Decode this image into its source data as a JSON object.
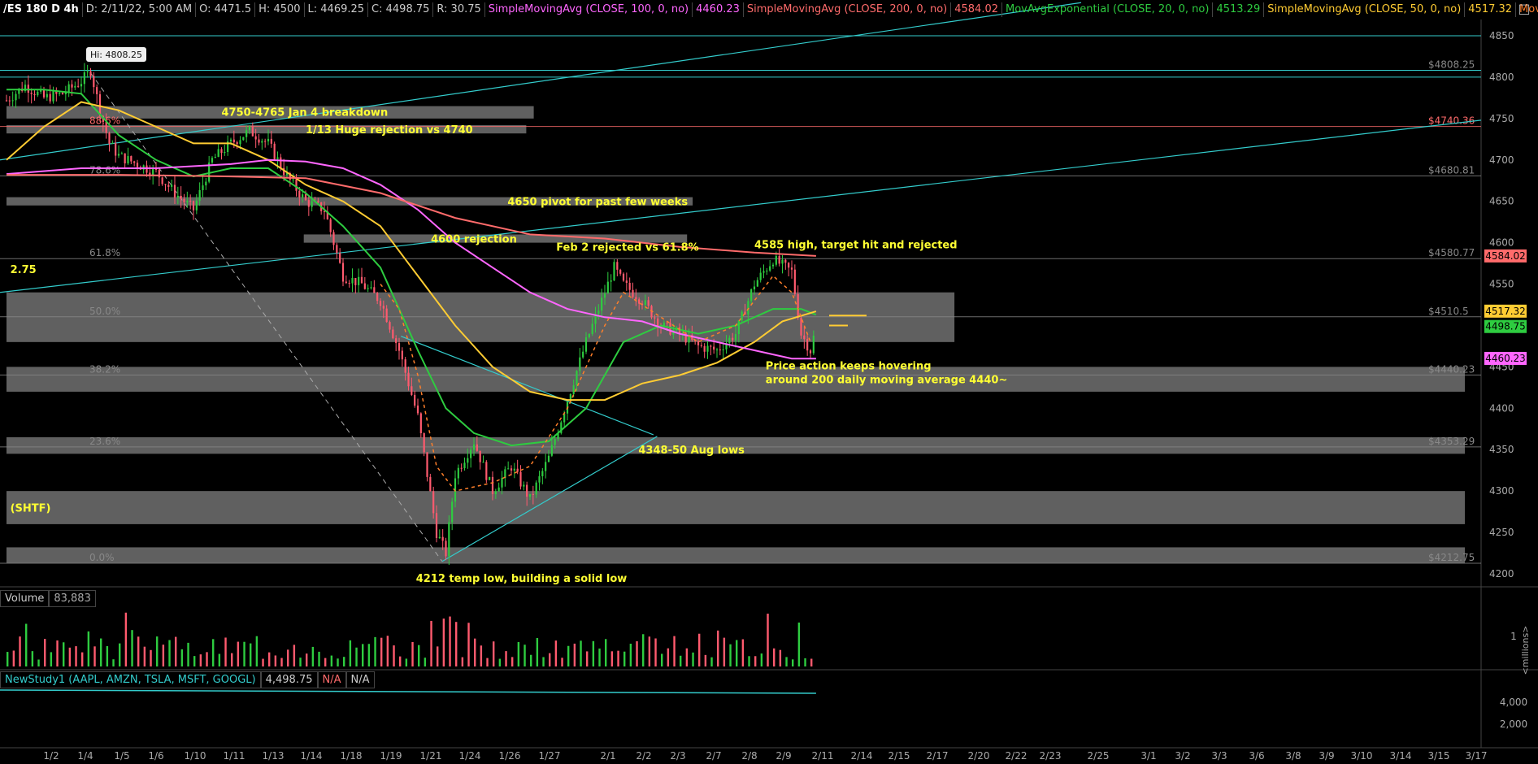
{
  "header": {
    "symbol": "/ES 180 D 4h",
    "date": "D: 2/11/22, 5:00 AM",
    "open": "O: 4471.5",
    "high": "H: 4500",
    "low": "L: 4469.25",
    "close": "C: 4498.75",
    "range": "R: 30.75",
    "studies": [
      {
        "label": "SimpleMovingAvg (CLOSE, 100, 0, no)",
        "value": "4460.23",
        "color": "#ff66ff"
      },
      {
        "label": "SimpleMovingAvg (CLOSE, 200, 0, no)",
        "value": "4584.02",
        "color": "#ff6b6b"
      },
      {
        "label": "MovAvgExponential (CLOSE, 20, 0, no)",
        "value": "4513.29",
        "color": "#2ecc40"
      },
      {
        "label": "SimpleMovingAvg (CLOSE, 50, 0, no)",
        "value": "4517.32",
        "color": "#ffcc33"
      },
      {
        "label": "MovAvgExponential ...",
        "value": "",
        "color": "#ff7f2a"
      }
    ]
  },
  "volume_header": {
    "label": "Volume",
    "value": "83,883"
  },
  "study_header": {
    "label": "NewStudy1 (AAPL, AMZN, TSLA, MSFT, GOOGL)",
    "value": "4,498.75",
    "na1": "N/A",
    "na2": "N/A"
  },
  "colors": {
    "up": "#2ecc40",
    "down": "#ff5a6e",
    "sma100": "#ff66ff",
    "sma200": "#ff6b6b",
    "ema20": "#2ecc40",
    "sma50": "#ffcc33",
    "trend": "#33cccc",
    "annotation": "#ffff33",
    "zone": "#808080"
  },
  "chart_data": {
    "type": "candlestick",
    "price_axis": {
      "ticks": [
        4200,
        4250,
        4300,
        4350,
        4400,
        4450,
        4500,
        4550,
        4600,
        4650,
        4700,
        4750,
        4800,
        4850
      ],
      "range": [
        4200,
        4865
      ]
    },
    "x_ticks": [
      "1/2",
      "1/4",
      "1/5",
      "1/6",
      "1/10",
      "1/11",
      "1/13",
      "1/14",
      "1/18",
      "1/19",
      "1/21",
      "1/24",
      "1/26",
      "1/27",
      "2/1",
      "2/2",
      "2/3",
      "2/7",
      "2/8",
      "2/9",
      "2/11",
      "2/14",
      "2/15",
      "2/17",
      "2/20",
      "2/22",
      "2/23",
      "2/25",
      "3/1",
      "3/2",
      "3/3",
      "3/6",
      "3/8",
      "3/9",
      "3/10",
      "3/14",
      "3/15",
      "3/17"
    ],
    "hi_label": "Hi: 4808.25",
    "price_labels": [
      {
        "text": "$4808.25",
        "price": 4808.25,
        "color": "#888888"
      },
      {
        "text": "$4740.36",
        "price": 4740.36,
        "color": "#ff6b6b"
      },
      {
        "text": "$4680.81",
        "price": 4680.81,
        "color": "#888888"
      },
      {
        "text": "$4580.77",
        "price": 4580.77,
        "color": "#888888"
      },
      {
        "text": "$4510.5",
        "price": 4510.5,
        "color": "#888888"
      },
      {
        "text": "$4440.23",
        "price": 4440.23,
        "color": "#888888"
      },
      {
        "text": "$4353.29",
        "price": 4353.29,
        "color": "#888888"
      },
      {
        "text": "$4212.75",
        "price": 4212.75,
        "color": "#888888"
      }
    ],
    "fib_levels": [
      {
        "label": "88.6%",
        "price": 4740.36,
        "color": "#ff6b6b"
      },
      {
        "label": "78.6%",
        "price": 4680.81,
        "color": "#888888"
      },
      {
        "label": "61.8%",
        "price": 4580.77,
        "color": "#888888"
      },
      {
        "label": "50.0%",
        "price": 4510.5,
        "color": "#888888"
      },
      {
        "label": "38.2%",
        "price": 4440.23,
        "color": "#888888"
      },
      {
        "label": "23.6%",
        "price": 4353.29,
        "color": "#888888"
      },
      {
        "label": "0.0%",
        "price": 4212.75,
        "color": "#888888"
      }
    ],
    "badges": [
      {
        "text": "4584.02",
        "price": 4584.02,
        "bg": "#ff6b6b",
        "fg": "#000000"
      },
      {
        "text": "4517.32",
        "price": 4517.32,
        "bg": "#ffcc33",
        "fg": "#000000"
      },
      {
        "text": "4498.75",
        "price": 4498.75,
        "bg": "#2ecc40",
        "fg": "#000000"
      },
      {
        "text": "4460.23",
        "price": 4460.23,
        "bg": "#ff66ff",
        "fg": "#000000"
      }
    ],
    "zones": [
      {
        "from_day": 0,
        "to_day": 28.2,
        "low": 4750,
        "high": 4765
      },
      {
        "from_day": 0,
        "to_day": 27.8,
        "low": 4732,
        "high": 4742
      },
      {
        "from_day": 0,
        "to_day": 36.7,
        "low": 4645,
        "high": 4655
      },
      {
        "from_day": 15.9,
        "to_day": 36.4,
        "low": 4600,
        "high": 4610
      },
      {
        "from_day": 0,
        "to_day": 50.7,
        "low": 4480,
        "high": 4540
      },
      {
        "from_day": 0,
        "to_day": 78,
        "low": 4420,
        "high": 4450
      },
      {
        "from_day": 0,
        "to_day": 78,
        "low": 4345,
        "high": 4365
      },
      {
        "from_day": 0,
        "to_day": 78,
        "low": 4260,
        "high": 4300
      },
      {
        "from_day": 0,
        "to_day": 78,
        "low": 4213,
        "high": 4232
      }
    ],
    "annotations": [
      {
        "text": "4750-4765 Jan 4 breakdown",
        "day": 11.5,
        "price": 4758
      },
      {
        "text": "1/13 Huge rejection vs 4740",
        "day": 16,
        "price": 4737
      },
      {
        "text": "4650 pivot for past few weeks",
        "day": 26.8,
        "price": 4650
      },
      {
        "text": "4600 rejection",
        "day": 22.7,
        "price": 4605
      },
      {
        "text": "Feb 2 rejected vs 61.8%",
        "day": 29.4,
        "price": 4595
      },
      {
        "text": "4585 high, target hit and rejected",
        "day": 40,
        "price": 4598
      },
      {
        "text": "Price action keeps hovering",
        "day": 40.6,
        "price": 4452
      },
      {
        "text": "around 200 daily moving average 4440~",
        "day": 40.6,
        "price": 4435
      },
      {
        "text": "4348-50 Aug lows",
        "day": 33.8,
        "price": 4350
      },
      {
        "text": "4212 temp low, building a solid low",
        "day": 21.9,
        "price": 4195
      },
      {
        "text": "(SHTF)",
        "day": 0.2,
        "price": 4280
      },
      {
        "text": "2.75",
        "day": 0.2,
        "price": 4568
      }
    ],
    "series": [
      {
        "name": "price",
        "points": [
          [
            0,
            4772
          ],
          [
            1,
            4790
          ],
          [
            2,
            4775
          ],
          [
            3,
            4780
          ],
          [
            4,
            4795
          ],
          [
            4.5,
            4808
          ],
          [
            5,
            4760
          ],
          [
            5.5,
            4720
          ],
          [
            6,
            4705
          ],
          [
            7,
            4695
          ],
          [
            8,
            4685
          ],
          [
            9,
            4660
          ],
          [
            10,
            4640
          ],
          [
            11,
            4700
          ],
          [
            12,
            4720
          ],
          [
            13,
            4735
          ],
          [
            14,
            4720
          ],
          [
            15,
            4680
          ],
          [
            16,
            4650
          ],
          [
            17,
            4640
          ],
          [
            18,
            4560
          ],
          [
            19,
            4550
          ],
          [
            20,
            4530
          ],
          [
            21,
            4470
          ],
          [
            22,
            4390
          ],
          [
            23,
            4250
          ],
          [
            23.5,
            4225
          ],
          [
            24,
            4320
          ],
          [
            25,
            4360
          ],
          [
            26,
            4300
          ],
          [
            27,
            4330
          ],
          [
            28,
            4290
          ],
          [
            29,
            4340
          ],
          [
            30,
            4410
          ],
          [
            31,
            4480
          ],
          [
            32,
            4540
          ],
          [
            32.5,
            4570
          ],
          [
            33,
            4550
          ],
          [
            34,
            4530
          ],
          [
            35,
            4500
          ],
          [
            36,
            4490
          ],
          [
            37,
            4475
          ],
          [
            38,
            4470
          ],
          [
            39,
            4490
          ],
          [
            40,
            4550
          ],
          [
            41,
            4580
          ],
          [
            42,
            4565
          ],
          [
            42.5,
            4490
          ],
          [
            43,
            4470
          ],
          [
            43.3,
            4498
          ]
        ]
      },
      {
        "name": "EMA20",
        "points": [
          [
            0,
            4785
          ],
          [
            2,
            4785
          ],
          [
            4,
            4780
          ],
          [
            6,
            4730
          ],
          [
            8,
            4700
          ],
          [
            10,
            4680
          ],
          [
            12,
            4690
          ],
          [
            14,
            4690
          ],
          [
            16,
            4660
          ],
          [
            18,
            4620
          ],
          [
            20,
            4570
          ],
          [
            22,
            4470
          ],
          [
            23.5,
            4400
          ],
          [
            25,
            4370
          ],
          [
            27,
            4355
          ],
          [
            29,
            4360
          ],
          [
            31,
            4400
          ],
          [
            33,
            4480
          ],
          [
            35,
            4500
          ],
          [
            37,
            4490
          ],
          [
            39,
            4500
          ],
          [
            41,
            4520
          ],
          [
            42.5,
            4520
          ],
          [
            43.3,
            4513
          ]
        ]
      },
      {
        "name": "SMA50",
        "points": [
          [
            0,
            4700
          ],
          [
            2,
            4740
          ],
          [
            4,
            4770
          ],
          [
            6,
            4760
          ],
          [
            8,
            4740
          ],
          [
            10,
            4720
          ],
          [
            12,
            4720
          ],
          [
            14,
            4700
          ],
          [
            16,
            4670
          ],
          [
            18,
            4650
          ],
          [
            20,
            4620
          ],
          [
            22,
            4560
          ],
          [
            24,
            4500
          ],
          [
            26,
            4450
          ],
          [
            28,
            4420
          ],
          [
            30,
            4410
          ],
          [
            32,
            4410
          ],
          [
            34,
            4430
          ],
          [
            36,
            4440
          ],
          [
            38,
            4455
          ],
          [
            40,
            4480
          ],
          [
            41.5,
            4505
          ],
          [
            43.3,
            4517
          ]
        ]
      },
      {
        "name": "SMA100",
        "points": [
          [
            0,
            4683
          ],
          [
            4,
            4690
          ],
          [
            8,
            4690
          ],
          [
            12,
            4695
          ],
          [
            14,
            4700
          ],
          [
            16,
            4698
          ],
          [
            18,
            4690
          ],
          [
            20,
            4670
          ],
          [
            22,
            4640
          ],
          [
            24,
            4600
          ],
          [
            26,
            4570
          ],
          [
            28,
            4540
          ],
          [
            30,
            4520
          ],
          [
            32,
            4510
          ],
          [
            34,
            4505
          ],
          [
            36,
            4490
          ],
          [
            38,
            4480
          ],
          [
            40,
            4470
          ],
          [
            42,
            4460
          ],
          [
            43.3,
            4460
          ]
        ]
      },
      {
        "name": "SMA200",
        "points": [
          [
            0,
            4682
          ],
          [
            6,
            4682
          ],
          [
            12,
            4680
          ],
          [
            16,
            4678
          ],
          [
            20,
            4660
          ],
          [
            24,
            4630
          ],
          [
            28,
            4610
          ],
          [
            32,
            4605
          ],
          [
            36,
            4595
          ],
          [
            40,
            4588
          ],
          [
            43.3,
            4584
          ]
        ]
      }
    ],
    "volume": {
      "axis_ticks": [
        "1"
      ],
      "axis_label": "<millions>"
    },
    "study": {
      "axis_ticks": [
        "4,000",
        "2,000"
      ]
    }
  }
}
